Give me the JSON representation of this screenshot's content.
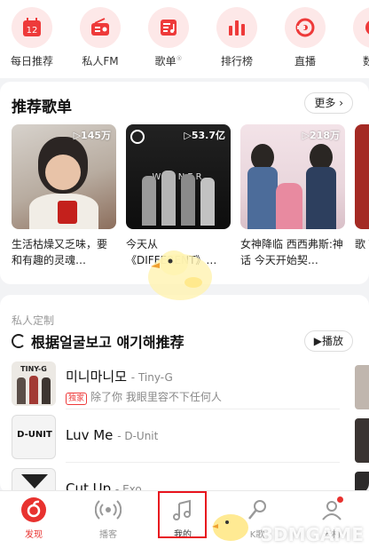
{
  "quick_entries": [
    {
      "label": "每日推荐",
      "icon": "calendar-icon",
      "day": "12"
    },
    {
      "label": "私人FM",
      "icon": "radio-icon"
    },
    {
      "label": "歌单",
      "icon": "playlist-icon",
      "sup": "®"
    },
    {
      "label": "排行榜",
      "icon": "ranking-icon"
    },
    {
      "label": "直播",
      "icon": "live-icon"
    },
    {
      "label": "数字",
      "icon": "digital-album-icon"
    }
  ],
  "recommended": {
    "title": "推荐歌单",
    "more_label": "更多",
    "playlists": [
      {
        "count": "▷145万",
        "name": "生活枯燥又乏味，要和有趣的灵魂…"
      },
      {
        "count": "▷53.7亿",
        "name": "今天从《DIFFERENT》…",
        "cover_text": "WINNER"
      },
      {
        "count": "▷218万",
        "name": "女神降临 西西弗斯:神话 今天开始契…"
      },
      {
        "count": "",
        "name": "歌 Tar"
      }
    ]
  },
  "personal": {
    "subtitle": "私人定制",
    "title": "根据얼굴보고 얘기해推荐",
    "play_label": "播放",
    "songs": [
      {
        "title": "미니마니모",
        "artist": "- Tiny-G",
        "badge": "独家",
        "desc": "除了你 我眼里容不下任何人",
        "thumb_text": "TINY-G"
      },
      {
        "title": "Luv Me",
        "artist": "- D-Unit",
        "badge": "",
        "desc": "",
        "thumb_text": "D-UNIT"
      },
      {
        "title": "Cut Up",
        "artist": "- Exo",
        "badge": "",
        "desc": "",
        "thumb_text": ""
      }
    ]
  },
  "tabs": [
    {
      "label": "发现",
      "icon": "discover-icon",
      "active": true
    },
    {
      "label": "播客",
      "icon": "podcast-icon",
      "active": false
    },
    {
      "label": "我的",
      "icon": "music-note-icon",
      "active": false
    },
    {
      "label": "K歌",
      "icon": "karaoke-icon",
      "active": false
    },
    {
      "label": "云村",
      "icon": "cloud-village-icon",
      "active": false
    }
  ],
  "watermark": "3DMGAME",
  "colors": {
    "brand_red": "#e8322f",
    "highlight_box": "#e8141e",
    "badge_red": "#ee3a3a"
  }
}
